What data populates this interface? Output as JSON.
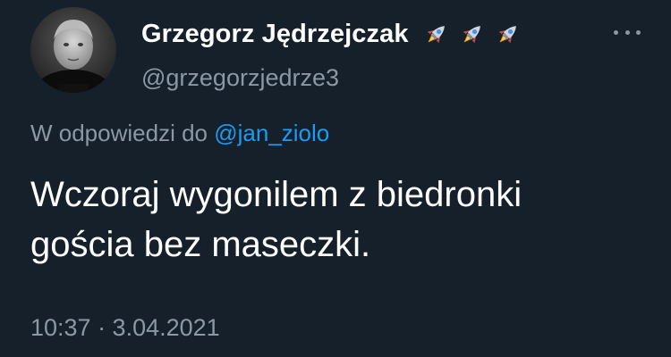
{
  "author": {
    "display_name": "Grzegorz Jędrzejczak",
    "handle": "@grzegorzjedrze3",
    "name_emojis": [
      "rocket-icon",
      "rocket-icon",
      "rocket-icon"
    ],
    "avatar_badge_text": "*****\n***"
  },
  "reply": {
    "prefix": "W odpowiedzi do",
    "mention": "@jan_ziolo"
  },
  "tweet": {
    "text": "Wczoraj wygonilem z biedronki\ngościa bez maseczki.",
    "time": "10:37 · 3.04.2021"
  },
  "colors": {
    "background": "#15202b",
    "text": "#ffffff",
    "secondary": "#8b98a5",
    "link": "#1d9bf0"
  }
}
